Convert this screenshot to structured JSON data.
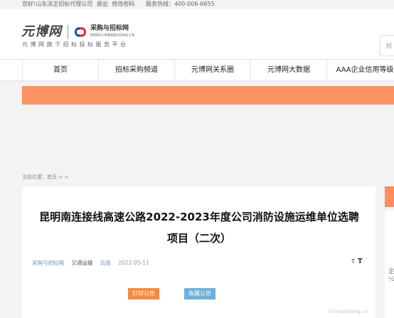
{
  "topbar": {
    "greeting": "您好!",
    "company": "山东法正招标代理公司",
    "logout": "退出",
    "change_password": "修改密码",
    "hotline": "服务热线：400-006-6655"
  },
  "header": {
    "logo_text": "元博网",
    "partner_name": "采购与招标网",
    "partner_url": "WWW.CHINABIDDING.CN",
    "slogan": "元博网旗下招标投标服务平台",
    "search_placeholder": "招"
  },
  "nav": {
    "items": [
      {
        "label": "首页"
      },
      {
        "label": "招标采购频道"
      },
      {
        "label": "元博网关系圈"
      },
      {
        "label": "元博网大数据"
      },
      {
        "label": "AAA企业信用等级"
      }
    ]
  },
  "breadcrumb": {
    "prefix": "当前位置：",
    "home": "首页",
    "tail": " >  >"
  },
  "article": {
    "title": "昆明南连接线高速公路2022-2023年度公司消防设施运维单位选聘项目（二次）",
    "source": "采购与招标网",
    "category": "交通运输",
    "region": "云南",
    "date": "2022-05-11",
    "font_small": "T",
    "font_large": "T",
    "print_button": "打印公告",
    "favorite_button": "收藏公告"
  },
  "sidebar": {
    "glyph1": "企",
    "glyph2": "½"
  },
  "watermark": "chinabidding.cn",
  "colors": {
    "banner": "#fc9363",
    "print_button": "#f5893f",
    "favorite_button": "#6fb0d8",
    "link": "#6a8fc9"
  }
}
